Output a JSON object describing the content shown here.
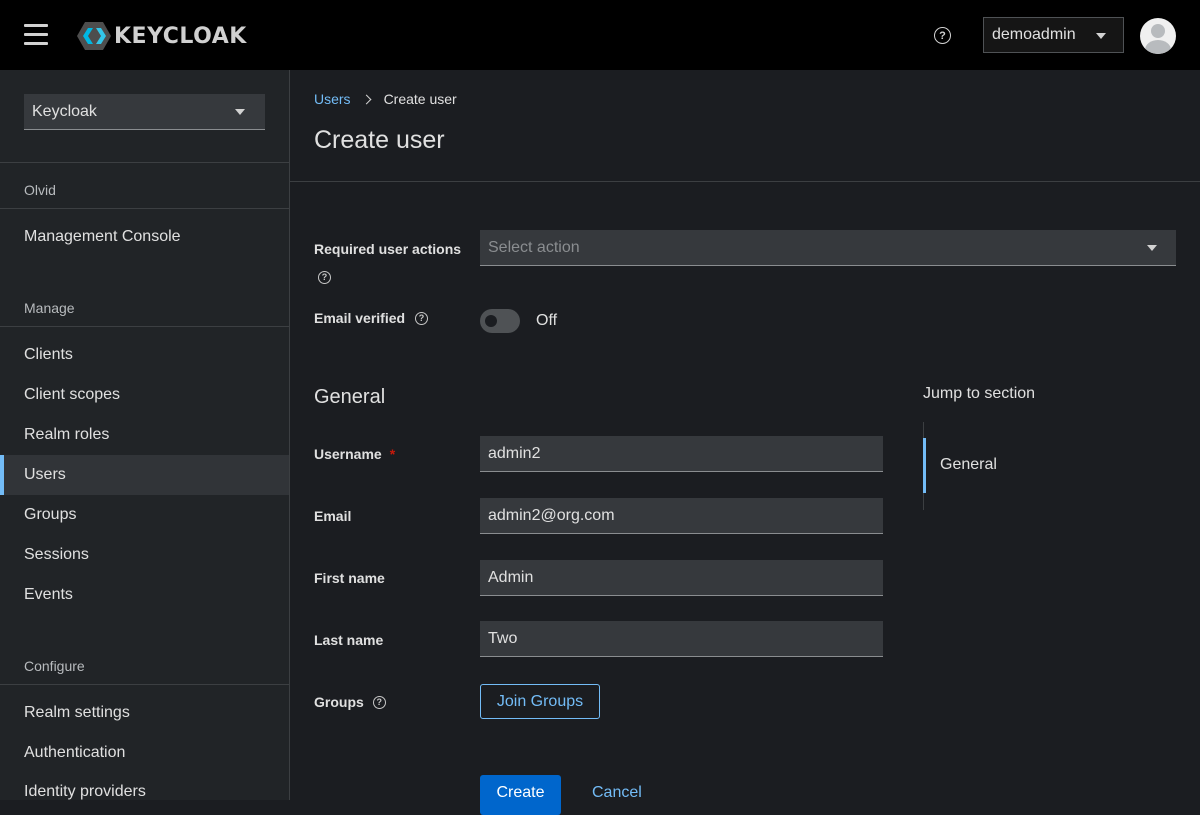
{
  "header": {
    "brand": "KEYCLOAK",
    "user_menu": "demoadmin"
  },
  "sidebar": {
    "realm": "Keycloak",
    "realm_section": "Olvid",
    "console_link": "Management Console",
    "manage_section": "Manage",
    "manage_items": [
      "Clients",
      "Client scopes",
      "Realm roles",
      "Users",
      "Groups",
      "Sessions",
      "Events"
    ],
    "active_item": "Users",
    "configure_section": "Configure",
    "configure_items": [
      "Realm settings",
      "Authentication",
      "Identity providers"
    ]
  },
  "breadcrumb": {
    "parent": "Users",
    "current": "Create user"
  },
  "page": {
    "title": "Create user"
  },
  "form": {
    "required_actions_label": "Required user actions",
    "required_actions_placeholder": "Select action",
    "email_verified_label": "Email verified",
    "email_verified_state": "Off",
    "email_verified_on": false,
    "general_title": "General",
    "username_label": "Username",
    "username_required_mark": "*",
    "username_value": "admin2",
    "email_label": "Email",
    "email_value": "admin2@org.com",
    "first_name_label": "First name",
    "first_name_value": "Admin",
    "last_name_label": "Last name",
    "last_name_value": "Two",
    "groups_label": "Groups",
    "join_groups_button": "Join Groups",
    "create_button": "Create",
    "cancel_button": "Cancel"
  },
  "jump_to": {
    "title": "Jump to section",
    "items": [
      "General"
    ]
  },
  "colors": {
    "accent": "#73bcf7",
    "primary": "#0066cc",
    "required": "#c9190b"
  }
}
